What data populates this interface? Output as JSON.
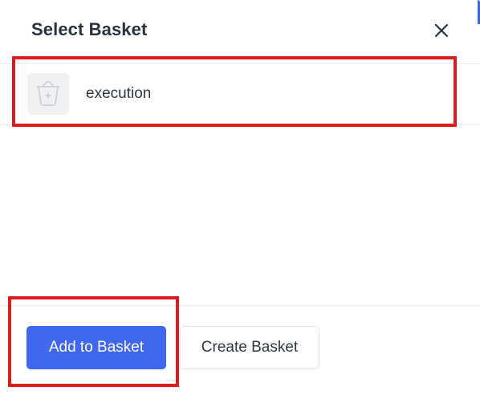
{
  "dialog": {
    "title": "Select Basket",
    "close_icon": "close-icon"
  },
  "baskets": [
    {
      "name": "execution",
      "icon": "basket-add-icon"
    }
  ],
  "footer": {
    "add_label": "Add to Basket",
    "create_label": "Create Basket"
  },
  "colors": {
    "primary": "#4068ee",
    "title_text": "#2a3240",
    "body_text": "#2f3744",
    "divider": "#e7e9ee",
    "annotation": "#e01b1b"
  }
}
